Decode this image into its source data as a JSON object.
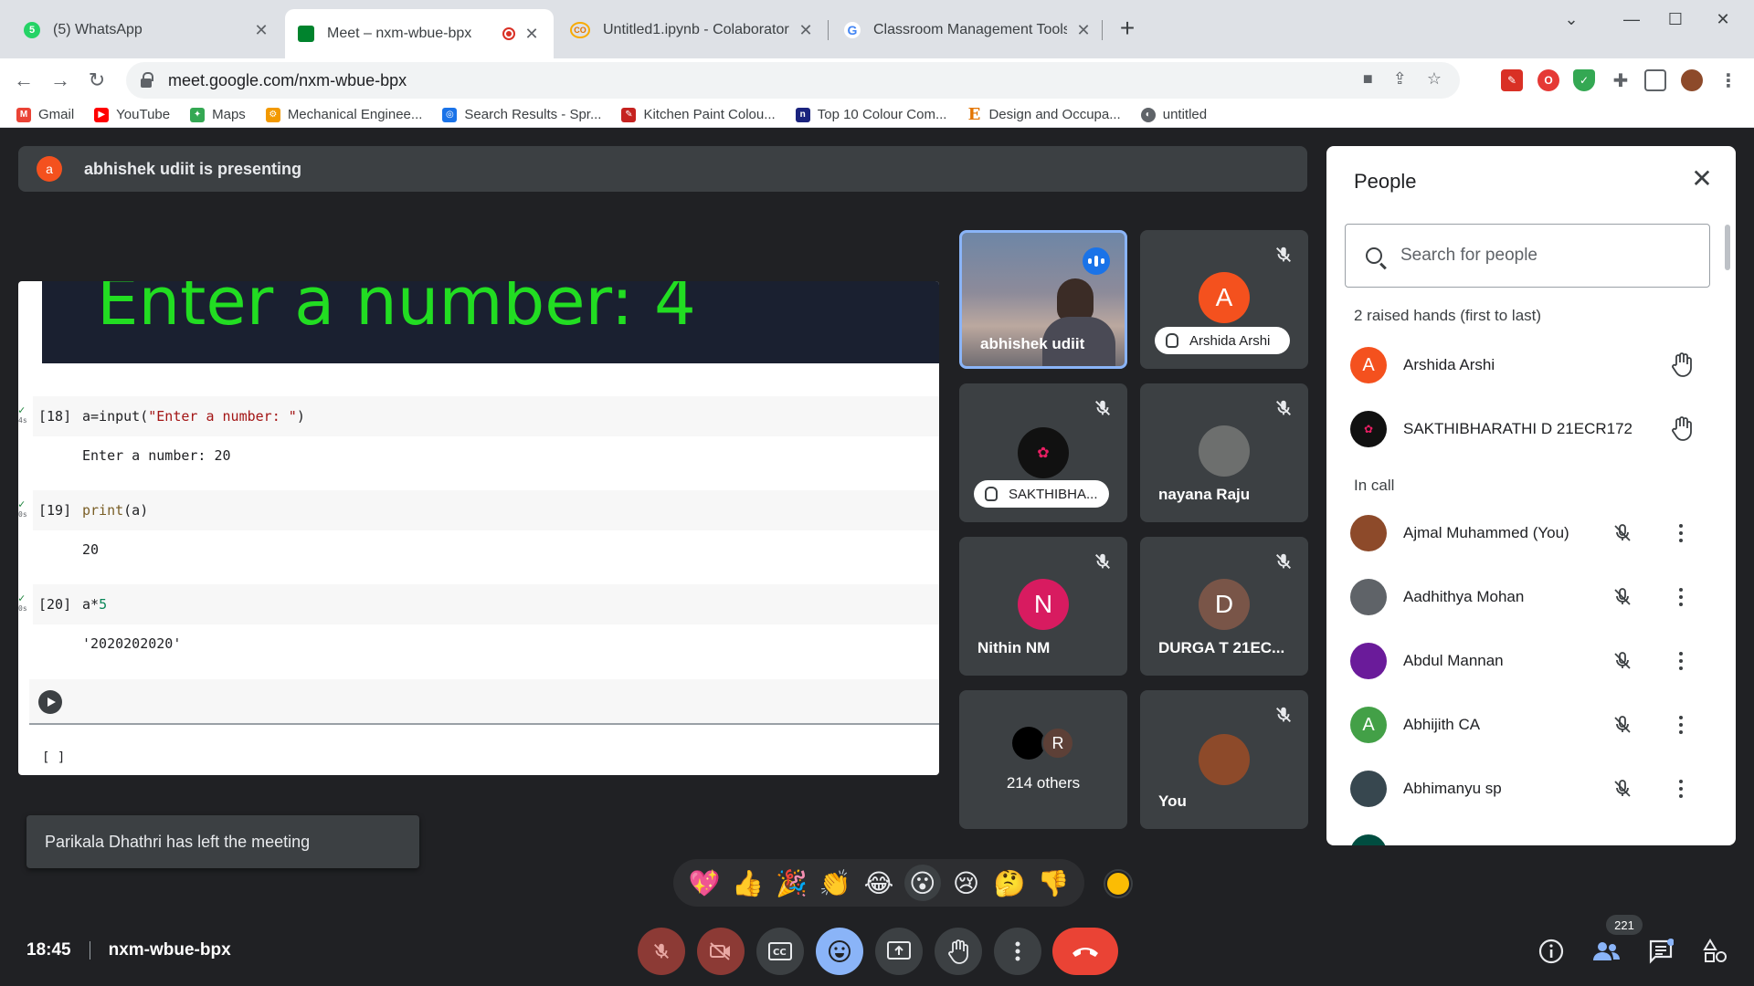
{
  "browser": {
    "tabs": [
      {
        "title": "(5) WhatsApp",
        "favicon_color": "#25d366",
        "favicon_text": "5"
      },
      {
        "title": "Meet – nxm-wbue-bpx",
        "favicon_color": "#00832d",
        "recording": true
      },
      {
        "title": "Untitled1.ipynb - Colaboratory",
        "favicon_color": "#f9ab00",
        "favicon_text": "CO"
      },
      {
        "title": "Classroom Management Tools &",
        "favicon_color": "#4285f4",
        "favicon_text": "G"
      }
    ],
    "url": "meet.google.com/nxm-wbue-bpx",
    "bookmarks": [
      {
        "label": "Gmail",
        "color": "#ea4335",
        "glyph": "M"
      },
      {
        "label": "YouTube",
        "color": "#ff0000",
        "glyph": "▶"
      },
      {
        "label": "Maps",
        "color": "#34a853",
        "glyph": "✦"
      },
      {
        "label": "Mechanical Enginee...",
        "color": "#f29900",
        "glyph": "⚙"
      },
      {
        "label": "Search Results - Spr...",
        "color": "#1a73e8",
        "glyph": "◎"
      },
      {
        "label": "Kitchen Paint Colou...",
        "color": "#c5221f",
        "glyph": "✎"
      },
      {
        "label": "Top 10 Colour Com...",
        "color": "#1a237e",
        "glyph": "n"
      },
      {
        "label": "Design and Occupa...",
        "color": "#e37400",
        "glyph": "E"
      },
      {
        "label": "untitled",
        "color": "#5f6368",
        "glyph": "◐"
      }
    ]
  },
  "meet": {
    "presenting_avatar": "a",
    "presenting_text": "abhishek udiit is presenting",
    "screen": {
      "banner_text": "Enter a number: 4",
      "cells": [
        {
          "number": "[18]",
          "code_fn": "a=input(",
          "code_str": "\"Enter a number: \"",
          "code_end": ")",
          "output": "Enter a number: 20",
          "time": "4s"
        },
        {
          "number": "[19]",
          "code_fn": "print",
          "code_rest": "(a)",
          "output": "20",
          "time": "0s"
        },
        {
          "number": "[20]",
          "code_a": "a*",
          "code_num": "5",
          "output": "'2020202020'",
          "time": "0s"
        }
      ],
      "empty_cell": "[ ]"
    },
    "tiles": [
      {
        "name": "abhishek udiit",
        "kind": "video"
      },
      {
        "name": "Arshida Arshi",
        "initial": "A",
        "color": "#f4511e",
        "raised_hand": true
      },
      {
        "name": "SAKTHIBHA...",
        "kind": "avatar-img",
        "raised_hand": true
      },
      {
        "name": "nayana Raju",
        "kind": "avatar-img"
      },
      {
        "name": "Nithin NM",
        "initial": "N",
        "color": "#d81b60"
      },
      {
        "name": "DURGA T 21EC...",
        "initial": "D",
        "color": "#795548"
      },
      {
        "name": "214 others",
        "second_initial": "R"
      },
      {
        "name": "You",
        "kind": "avatar-img"
      }
    ],
    "toast": "Parikala Dhathri has left the meeting",
    "reactions": [
      "💖",
      "👍",
      "🎉",
      "👏",
      "😂",
      "😮",
      "😢",
      "🤔",
      "👎"
    ],
    "time": "18:45",
    "meeting_code": "nxm-wbue-bpx",
    "participant_count": "221",
    "people_panel": {
      "title": "People",
      "search_placeholder": "Search for people",
      "raised_section": "2 raised hands (first to last)",
      "raised": [
        {
          "name": "Arshida Arshi",
          "initial": "A",
          "color": "#f4511e"
        },
        {
          "name": "SAKTHIBHARATHI D 21ECR172",
          "color": "#111111"
        }
      ],
      "incall_section": "In call",
      "incall": [
        {
          "name": "Ajmal Muhammed (You)",
          "color": "#8d4a2a"
        },
        {
          "name": "Aadhithya Mohan",
          "color": "#5f6368"
        },
        {
          "name": "Abdul Mannan",
          "color": "#6a1b9a"
        },
        {
          "name": "Abhijith CA",
          "initial": "A",
          "color": "#43a047"
        },
        {
          "name": "Abhimanyu sp",
          "color": "#37474f"
        }
      ]
    },
    "colors": {
      "bg": "#202124",
      "surface": "#3c4043",
      "accent_blue": "#8ab4f8",
      "end_call_red": "#ea4335"
    }
  }
}
